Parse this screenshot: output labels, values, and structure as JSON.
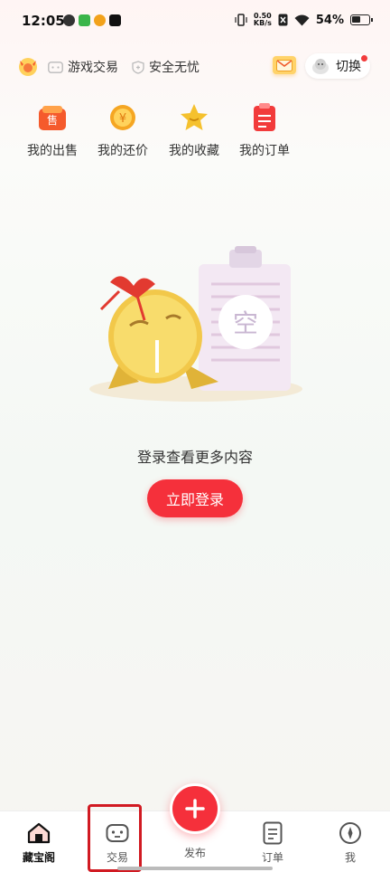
{
  "status_bar": {
    "time": "12:05",
    "net_speed_value": "0.50",
    "net_speed_unit": "KB/s",
    "battery": "54%"
  },
  "header": {
    "game_trade_label": "游戏交易",
    "safe_label": "安全无忧",
    "switch_label": "切换"
  },
  "quick_actions": [
    {
      "label": "我的出售",
      "icon": "sell-icon",
      "badge_text": "售",
      "color": "#f55a2c"
    },
    {
      "label": "我的还价",
      "icon": "counteroffer-icon",
      "badge_text": "¥",
      "color": "#f5a623"
    },
    {
      "label": "我的收藏",
      "icon": "star-icon",
      "color": "#f5c12e"
    },
    {
      "label": "我的订单",
      "icon": "order-icon",
      "color": "#f23b3b"
    }
  ],
  "empty_state": {
    "badge_text": "空",
    "message": "登录查看更多内容",
    "login_button": "立即登录"
  },
  "bottom_nav": {
    "home": "藏宝阁",
    "trade": "交易",
    "publish": "发布",
    "order": "订单",
    "me": "我"
  },
  "colors": {
    "accent": "#f5303b",
    "highlight": "#d11a22"
  }
}
